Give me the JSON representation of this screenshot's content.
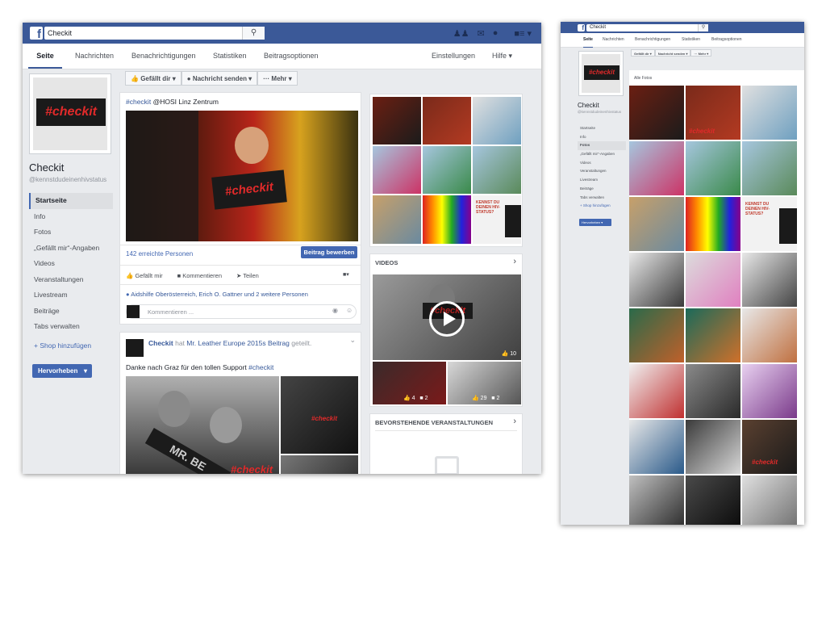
{
  "main": {
    "header": {
      "search_value": "Checkit"
    },
    "tabs": [
      "Seite",
      "Nachrichten",
      "Benachrichtigungen",
      "Statistiken",
      "Beitragsoptionen",
      "Einstellungen",
      "Hilfe ▾"
    ],
    "profile": {
      "logo_text": "#checkit",
      "name": "Checkit",
      "username": "@kennstdudeinenhivstatus"
    },
    "sidenav": [
      "Startseite",
      "Info",
      "Fotos",
      "„Gefällt mir“-Angaben",
      "Videos",
      "Veranstaltungen",
      "Livestream",
      "Beiträge",
      "Tabs verwalten"
    ],
    "shop_link": "+ Shop hinzufügen",
    "promote_button": "Hervorheben",
    "actionbar": [
      "Gefällt dir ▾",
      "Nachricht senden ▾",
      "··· Mehr ▾"
    ],
    "post1": {
      "hashtag": "#checkit",
      "text": "@HOSI Linz Zentrum",
      "photo_text": "#checkit",
      "reach": "142 erreichte Personen",
      "boost": "Beitrag bewerben",
      "like": "Gefällt mir",
      "comment": "Kommentieren",
      "share": "Teilen",
      "likers": "Aidshilfe Oberösterreich, Erich O. Gattner und 2 weitere Personen",
      "comment_placeholder": "Kommentieren ..."
    },
    "post2": {
      "author": "Checkit",
      "shared_a": "hat",
      "shared_source": "Mr. Leather Europe 2015s Beitrag",
      "shared_b": "geteilt.",
      "text": "Danke nach Graz für den tollen Support",
      "hashtag": "#checkit",
      "photo_sash": "MR. BE",
      "photo_tag": "#checkit"
    },
    "right": {
      "videos_title": "VIDEOS",
      "video_likes": "10",
      "small_videos": [
        {
          "likes": "4",
          "comments": "2"
        },
        {
          "likes": "29",
          "comments": "2"
        }
      ],
      "events_title": "BEVORSTEHENDE VERANSTALTUNGEN",
      "poster_text": "KENNST DU DEINEN HIV-STATUS?"
    }
  },
  "side": {
    "search_value": "Checkit",
    "tabs": [
      "Seite",
      "Nachrichten",
      "Benachrichtigungen",
      "Statistiken",
      "Beitragsoptionen"
    ],
    "actionbar": [
      "Gefällt dir ▾",
      "Nachricht senden ▾",
      "··· Mehr ▾"
    ],
    "name": "Checkit",
    "username": "@kennstdudeinenhivstatus",
    "sidenav": [
      "Startseite",
      "Info",
      "Fotos",
      "„Gefällt mir“-Angaben",
      "Videos",
      "Veranstaltungen",
      "Livestream",
      "Beiträge",
      "Tabs verwalten",
      "+ Shop hinzufügen"
    ],
    "promote_button": "Hervorheben ▾",
    "photos_title": "Alle Fotos",
    "poster_text": "KENNST DU DEINEN HIV-STATUS?",
    "photo_tag": "#checkit"
  }
}
